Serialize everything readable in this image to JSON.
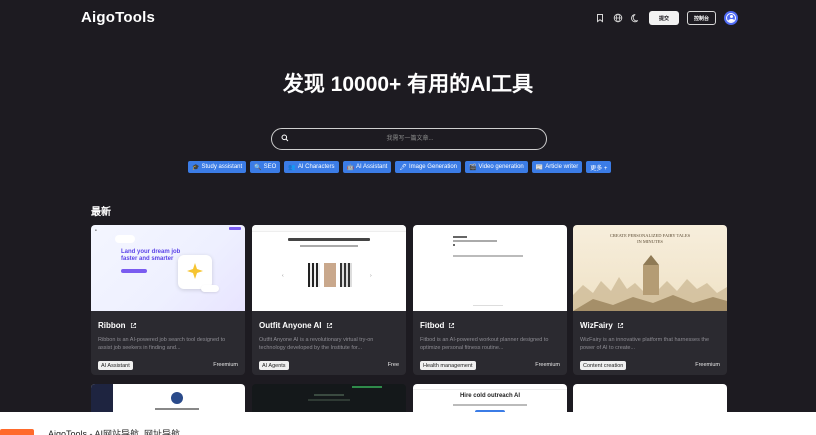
{
  "header": {
    "logo": "AigoTools",
    "submit_label": "提交",
    "console_label": "控制台",
    "icons": [
      "bookmark-icon",
      "globe-icon",
      "moon-icon"
    ]
  },
  "hero": {
    "title": "发现 10000+ 有用的AI工具",
    "search_placeholder": "我需写一篇文章..."
  },
  "tags": [
    {
      "icon": "🎓",
      "label": "Study assistant"
    },
    {
      "icon": "🔍",
      "label": "SEO"
    },
    {
      "icon": "👥",
      "label": "AI Characters"
    },
    {
      "icon": "🤖",
      "label": "AI Assistant"
    },
    {
      "icon": "🖊",
      "label": "Image Generation"
    },
    {
      "icon": "🎬",
      "label": "Video generation"
    },
    {
      "icon": "📰",
      "label": "Article writer"
    },
    {
      "icon": "",
      "label": "更多 +"
    }
  ],
  "section_title": "最新",
  "cards": [
    {
      "title": "Ribbon",
      "desc": "Ribbon is an AI-powered job search tool designed to assist job seekers in finding and...",
      "tag": "AI Assistant",
      "price": "Freemium",
      "thumb": {
        "headline": "Land your dream job faster and smarter"
      }
    },
    {
      "title": "Outfit Anyone AI",
      "desc": "Outfit Anyone AI is a revolutionary virtual try-on technology developed by the Institute for...",
      "tag": "AI Agents",
      "price": "Free",
      "thumb": {}
    },
    {
      "title": "Fitbod",
      "desc": "Fitbod is an AI-powered workout planner designed to optimize personal fitness routine...",
      "tag": "Health management",
      "price": "Freemium",
      "thumb": {}
    },
    {
      "title": "WizFairy",
      "desc": "WizFairy is an innovative platform that harnesses the power of AI to create...",
      "tag": "Content creation",
      "price": "Freemium",
      "thumb": {
        "headline": "CREATE PERSONALIZED FAIRY TALES IN MINUTES"
      }
    }
  ],
  "row2": [
    {
      "title": ""
    },
    {
      "title": ""
    },
    {
      "title": "Hire cold outreach AI"
    },
    {
      "title": ""
    }
  ],
  "bottom": {
    "text": "AigoTools - AI网站导航, 网址导航"
  },
  "colors": {
    "background": "#1d1b21",
    "card": "#2b2a30",
    "tag": "#3b7ce6",
    "accent": "#ff6a2b"
  }
}
